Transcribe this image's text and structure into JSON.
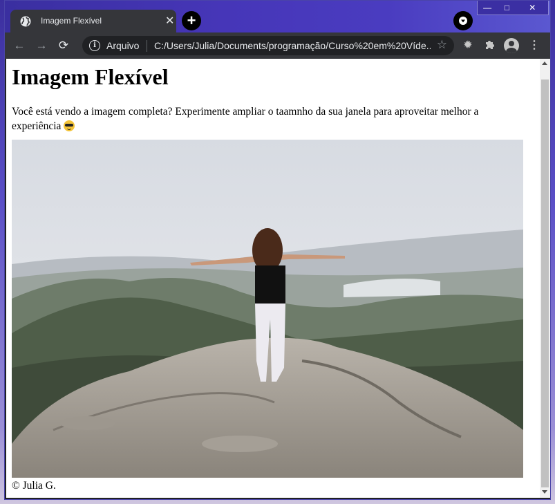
{
  "browser": {
    "tab": {
      "title": "Imagem Flexível",
      "close": "✕",
      "favicon": "globe-icon"
    },
    "new_tab": "+",
    "window_controls": {
      "minimize": "—",
      "maximize": "□",
      "close": "✕"
    },
    "address_bar": {
      "scheme_label": "Arquivo",
      "url": "C:/Users/Julia/Documents/programação/Curso%20em%20Víde..."
    }
  },
  "page": {
    "title": "Imagem Flexível",
    "description": "Você está vendo a imagem completa? Experimente ampliar o taamnho da sua janela para aproveitar melhor a experiência",
    "image_alt": "Mulher de braços abertos no topo de uma montanha",
    "credit": "© Julia G."
  },
  "colors": {
    "tab_bg": "#35363a",
    "toolbar_bg": "#35363a",
    "frame": "#4636b8"
  }
}
